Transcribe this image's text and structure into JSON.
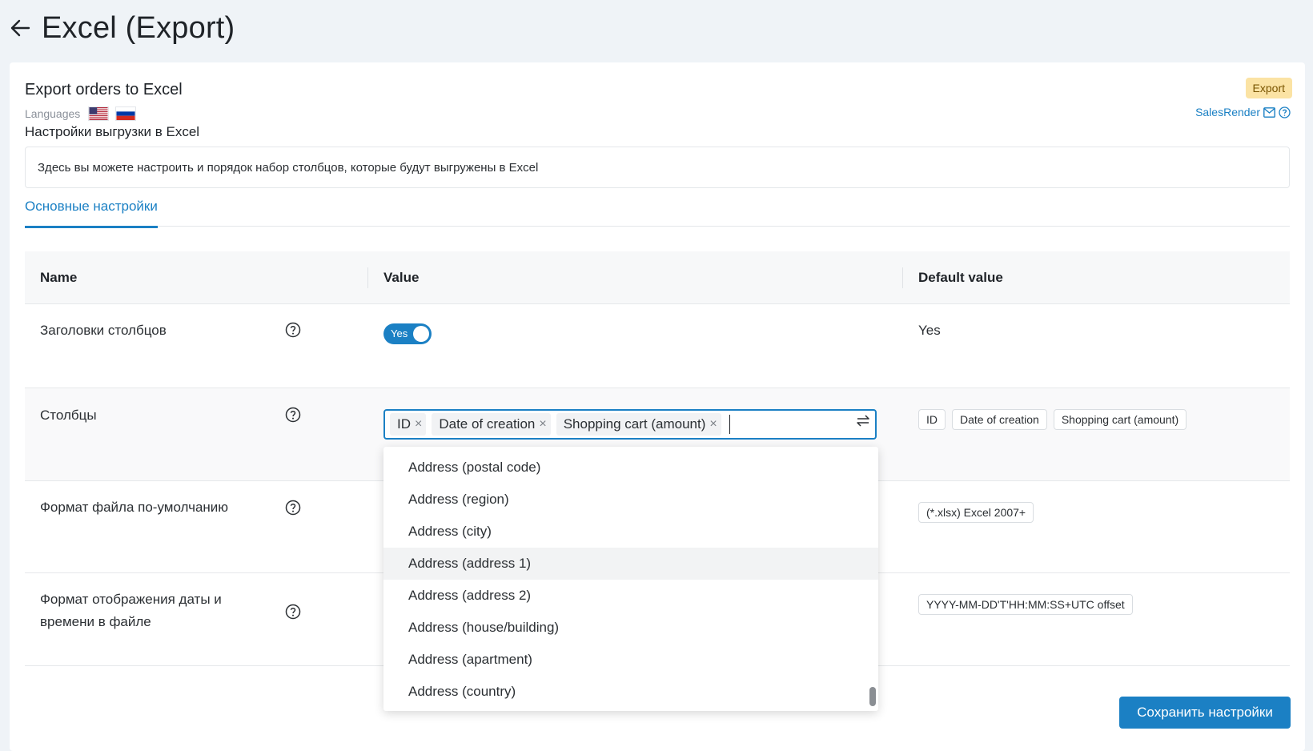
{
  "page": {
    "title": "Excel (Export)"
  },
  "plugin": {
    "title": "Export orders to Excel",
    "languages_label": "Languages",
    "languages": [
      "us-flag-icon",
      "ru-flag-icon"
    ],
    "badge": "Export",
    "brand": "SalesRender",
    "section_title": "Настройки выгрузки в Excel",
    "description": "Здесь вы можете настроить и порядок набор столбцов, которые будут выгружены в Excel"
  },
  "tabs": [
    {
      "label": "Основные настройки",
      "active": true
    }
  ],
  "table": {
    "headers": {
      "name": "Name",
      "value": "Value",
      "default": "Default value"
    },
    "rows": [
      {
        "name": "Заголовки столбцов",
        "value": "Yes",
        "default": "Yes"
      },
      {
        "name": "Столбцы",
        "value_chips": [
          "ID",
          "Date of creation",
          "Shopping cart (amount)"
        ],
        "default_tags": [
          "ID",
          "Date of creation",
          "Shopping cart (amount)"
        ]
      },
      {
        "name": "Формат файла по-умолчанию",
        "default_tags": [
          "(*.xlsx) Excel 2007+"
        ]
      },
      {
        "name_line1": "Формат отображения даты и",
        "name_line2": "времени в файле",
        "default_tags": [
          "YYYY-MM-DD'T'HH:MM:SS+UTC offset"
        ]
      }
    ]
  },
  "dropdown": {
    "options": [
      "Address (postal code)",
      "Address (region)",
      "Address (city)",
      "Address (address 1)",
      "Address (address 2)",
      "Address (house/building)",
      "Address (apartment)",
      "Address (country)"
    ],
    "highlighted": "Address (address 1)"
  },
  "actions": {
    "save": "Сохранить настройки"
  },
  "colors": {
    "accent": "#1b80c4",
    "badge_bg": "#fbe3a4",
    "background": "#eff3f7"
  }
}
